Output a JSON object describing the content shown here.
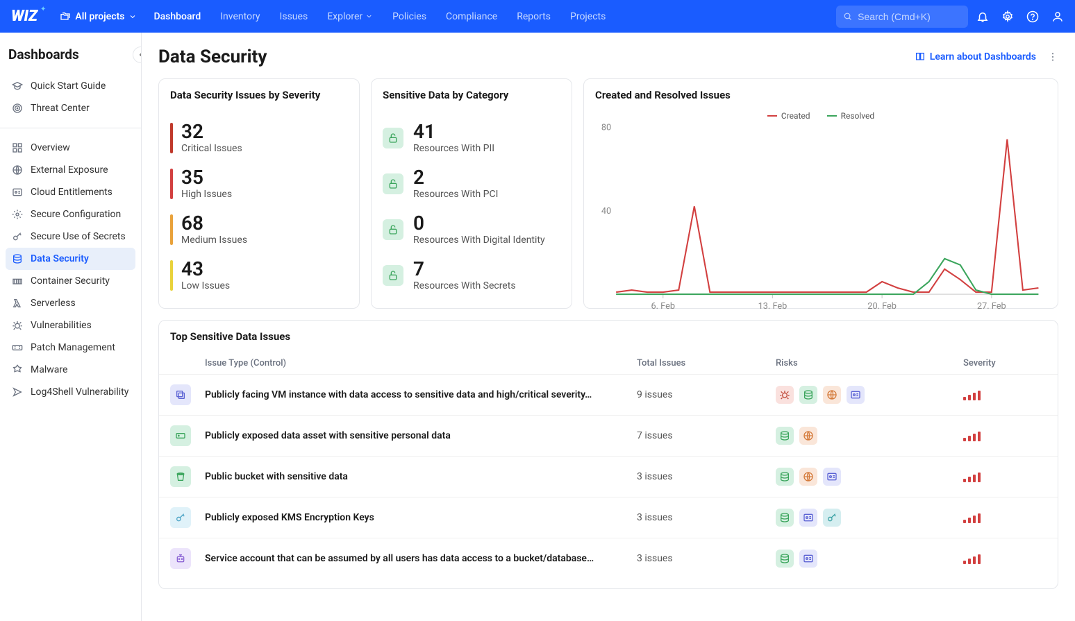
{
  "topnav": {
    "logo": "WIZ",
    "projects_label": "All projects",
    "links": [
      "Dashboard",
      "Inventory",
      "Issues",
      "Explorer",
      "Policies",
      "Compliance",
      "Reports",
      "Projects"
    ],
    "active_link": "Dashboard",
    "search_placeholder": "Search (Cmd+K)"
  },
  "sidebar": {
    "title": "Dashboards",
    "section1": [
      {
        "label": "Quick Start Guide",
        "icon": "mortarboard"
      },
      {
        "label": "Threat Center",
        "icon": "target"
      }
    ],
    "section2": [
      {
        "label": "Overview",
        "icon": "grid"
      },
      {
        "label": "External Exposure",
        "icon": "globe"
      },
      {
        "label": "Cloud Entitlements",
        "icon": "id"
      },
      {
        "label": "Secure Configuration",
        "icon": "gear"
      },
      {
        "label": "Secure Use of Secrets",
        "icon": "key"
      },
      {
        "label": "Data Security",
        "icon": "database",
        "active": true
      },
      {
        "label": "Container Security",
        "icon": "container"
      },
      {
        "label": "Serverless",
        "icon": "lambda"
      },
      {
        "label": "Vulnerabilities",
        "icon": "bug"
      },
      {
        "label": "Patch Management",
        "icon": "patch"
      },
      {
        "label": "Malware",
        "icon": "malware"
      },
      {
        "label": "Log4Shell Vulnerability",
        "icon": "shell"
      }
    ]
  },
  "page": {
    "title": "Data Security",
    "learn_link": "Learn about Dashboards"
  },
  "severity_card": {
    "title": "Data Security Issues by Severity",
    "items": [
      {
        "value": "32",
        "label": "Critical Issues",
        "color": "#c0392b"
      },
      {
        "value": "35",
        "label": "High Issues",
        "color": "#d24040"
      },
      {
        "value": "68",
        "label": "Medium Issues",
        "color": "#e9a23b"
      },
      {
        "value": "43",
        "label": "Low Issues",
        "color": "#e9d23b"
      }
    ]
  },
  "category_card": {
    "title": "Sensitive Data by Category",
    "items": [
      {
        "value": "41",
        "label": "Resources With PII"
      },
      {
        "value": "2",
        "label": "Resources With PCI"
      },
      {
        "value": "0",
        "label": "Resources With Digital Identity"
      },
      {
        "value": "7",
        "label": "Resources With Secrets"
      }
    ]
  },
  "chart_card": {
    "title": "Created and Resolved Issues"
  },
  "chart_data": {
    "type": "line",
    "x_labels": [
      "6. Feb",
      "13. Feb",
      "20. Feb",
      "27. Feb"
    ],
    "x": [
      3,
      4,
      5,
      6,
      7,
      8,
      9,
      10,
      11,
      12,
      13,
      14,
      15,
      16,
      17,
      18,
      19,
      20,
      21,
      22,
      23,
      24,
      25,
      26,
      27,
      28,
      29,
      30
    ],
    "ylim": [
      0,
      80
    ],
    "yticks": [
      40,
      80
    ],
    "legend": [
      "Created",
      "Resolved"
    ],
    "series": [
      {
        "name": "Created",
        "color": "#d24040",
        "values": [
          1,
          2,
          1,
          1,
          2,
          42,
          1,
          1,
          1,
          1,
          1,
          1,
          1,
          1,
          1,
          1,
          1,
          6,
          3,
          1,
          1,
          12,
          7,
          1,
          1,
          74,
          2,
          3
        ]
      },
      {
        "name": "Resolved",
        "color": "#3ba55c",
        "values": [
          0,
          0,
          0,
          0,
          0,
          0,
          0,
          0,
          0,
          0,
          0,
          0,
          0,
          0,
          0,
          0,
          0,
          0,
          0,
          0,
          6,
          17,
          14,
          2,
          0,
          0,
          0,
          0
        ]
      }
    ]
  },
  "table_card": {
    "title": "Top Sensitive Data Issues",
    "headers": {
      "type": "Issue Type (Control)",
      "total": "Total Issues",
      "risks": "Risks",
      "severity": "Severity"
    },
    "rows": [
      {
        "icon_bg": "#e4e6fb",
        "icon_color": "#5b62d4",
        "icon": "copy",
        "title": "Publicly facing VM instance with data access to sensitive data and high/critical severity…",
        "count": "9 issues",
        "risks": [
          "bug",
          "db",
          "globe",
          "id"
        ]
      },
      {
        "icon_bg": "#d5f0e1",
        "icon_color": "#3ba55c",
        "icon": "drive",
        "title": "Publicly exposed data asset with sensitive personal data",
        "count": "7 issues",
        "risks": [
          "db",
          "globe"
        ]
      },
      {
        "icon_bg": "#d5f0e1",
        "icon_color": "#3ba55c",
        "icon": "bucket",
        "title": "Public bucket with sensitive data",
        "count": "3 issues",
        "risks": [
          "db",
          "globe",
          "id"
        ]
      },
      {
        "icon_bg": "#e0f2f9",
        "icon_color": "#4aa3c5",
        "icon": "key",
        "title": "Publicly exposed KMS Encryption Keys",
        "count": "3 issues",
        "risks": [
          "db",
          "id",
          "key"
        ]
      },
      {
        "icon_bg": "#ece4fb",
        "icon_color": "#8a62d4",
        "icon": "robot",
        "title": "Service account that can be assumed by all users has data access to a bucket/database…",
        "count": "3 issues",
        "risks": [
          "db",
          "id"
        ]
      }
    ]
  },
  "risk_colors": {
    "bug": {
      "bg": "#fae1de",
      "fg": "#c04a3a"
    },
    "db": {
      "bg": "#d5f0e1",
      "fg": "#3ba55c"
    },
    "globe": {
      "bg": "#fae6d9",
      "fg": "#d47a3a"
    },
    "id": {
      "bg": "#e4e6fb",
      "fg": "#5b62d4"
    },
    "key": {
      "bg": "#d5eef0",
      "fg": "#3ba2a5"
    }
  }
}
